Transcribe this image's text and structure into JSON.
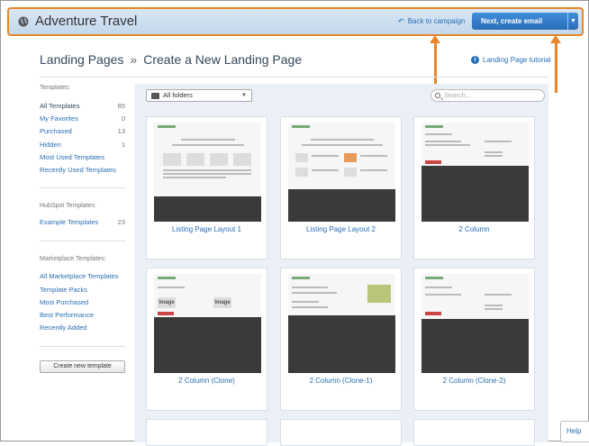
{
  "header": {
    "app_title": "Adventure Travel",
    "back_label": "Back to campaign",
    "next_label": "Next, create email"
  },
  "page": {
    "breadcrumb_parent": "Landing Pages",
    "breadcrumb_sep": "»",
    "title": "Create a New Landing Page",
    "tutorial_label": "Landing Page tutorial"
  },
  "sidebar": {
    "templates_heading": "Templates:",
    "templates": [
      {
        "label": "All Templates",
        "count": "85"
      },
      {
        "label": "My Favorites",
        "count": "0"
      },
      {
        "label": "Purchased",
        "count": "13"
      },
      {
        "label": "Hidden",
        "count": "1"
      },
      {
        "label": "Most Used Templates",
        "count": ""
      },
      {
        "label": "Recently Used Templates",
        "count": ""
      }
    ],
    "hubspot_heading": "HubSpot Templates:",
    "hubspot": [
      {
        "label": "Example Templates",
        "count": "23"
      }
    ],
    "marketplace_heading": "Marketplace Templates:",
    "marketplace": [
      {
        "label": "All Marketplace Templates"
      },
      {
        "label": "Template Packs"
      },
      {
        "label": "Most Purchased"
      },
      {
        "label": "Best Performance"
      },
      {
        "label": "Recently Added"
      }
    ],
    "create_label": "Create new template"
  },
  "toolbar": {
    "folder_value": "All folders",
    "search_placeholder": "Search..."
  },
  "cards": [
    {
      "label": "Listing Page Layout 1"
    },
    {
      "label": "Listing Page Layout 2"
    },
    {
      "label": "2 Column"
    },
    {
      "label": "2 Column (Clone)",
      "image_label": "Image"
    },
    {
      "label": "2 Column (Clone-1)"
    },
    {
      "label": "2 Column (Clone-2)"
    }
  ],
  "help_label": "Help",
  "colors": {
    "accent": "#e8852b",
    "link": "#2a6eb5",
    "primary_button": "#2a6db8"
  }
}
